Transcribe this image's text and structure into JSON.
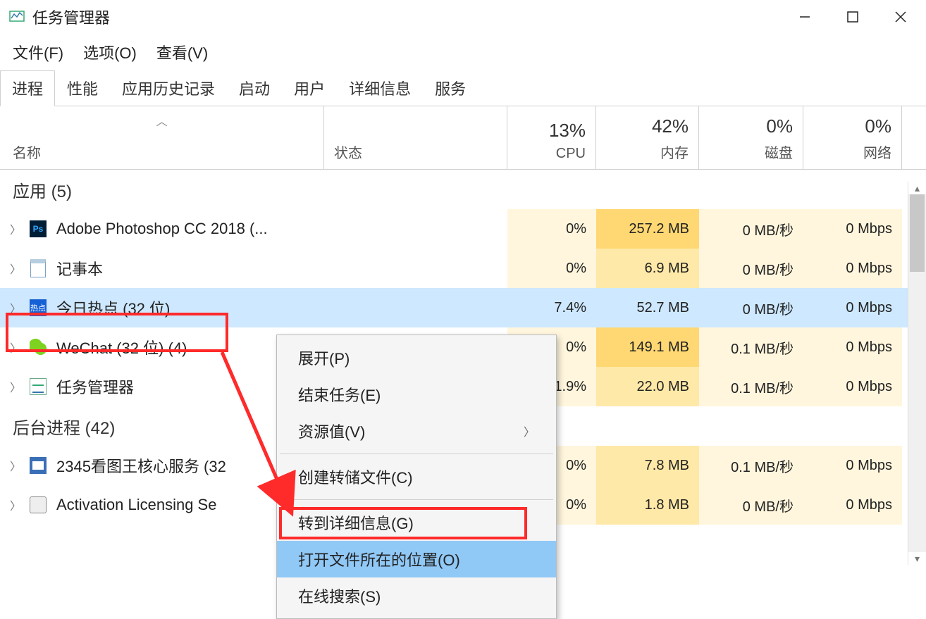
{
  "window": {
    "title": "任务管理器"
  },
  "menu": {
    "file": "文件(F)",
    "options": "选项(O)",
    "view": "查看(V)"
  },
  "tabs": [
    "进程",
    "性能",
    "应用历史记录",
    "启动",
    "用户",
    "详细信息",
    "服务"
  ],
  "active_tab": 0,
  "columns": {
    "name": "名称",
    "state": "状态",
    "cpu": {
      "pct": "13%",
      "label": "CPU"
    },
    "mem": {
      "pct": "42%",
      "label": "内存"
    },
    "disk": {
      "pct": "0%",
      "label": "磁盘"
    },
    "net": {
      "pct": "0%",
      "label": "网络"
    }
  },
  "groups": {
    "apps": {
      "label": "应用 (5)"
    },
    "bg": {
      "label": "后台进程 (42)"
    }
  },
  "rows": [
    {
      "name": "Adobe Photoshop CC 2018 (...",
      "cpu": "0%",
      "mem": "257.2 MB",
      "disk": "0 MB/秒",
      "net": "0 Mbps",
      "icon": "ps"
    },
    {
      "name": "记事本",
      "cpu": "0%",
      "mem": "6.9 MB",
      "disk": "0 MB/秒",
      "net": "0 Mbps",
      "icon": "note"
    },
    {
      "name": "今日热点 (32 位)",
      "cpu": "7.4%",
      "mem": "52.7 MB",
      "disk": "0 MB/秒",
      "net": "0 Mbps",
      "icon": "hot",
      "selected": true
    },
    {
      "name": "WeChat (32 位) (4)",
      "cpu": "0%",
      "mem": "149.1 MB",
      "disk": "0.1 MB/秒",
      "net": "0 Mbps",
      "icon": "wechat"
    },
    {
      "name": "任务管理器",
      "cpu": "1.9%",
      "mem": "22.0 MB",
      "disk": "0.1 MB/秒",
      "net": "0 Mbps",
      "icon": "tm"
    }
  ],
  "bg_rows": [
    {
      "name": "2345看图王核心服务 (32",
      "cpu": "0%",
      "mem": "7.8 MB",
      "disk": "0.1 MB/秒",
      "net": "0 Mbps",
      "icon": "2345"
    },
    {
      "name": "Activation Licensing Se",
      "cpu": "0%",
      "mem": "1.8 MB",
      "disk": "0 MB/秒",
      "net": "0 Mbps",
      "icon": "act"
    }
  ],
  "context_menu": {
    "items": [
      {
        "label": "展开(P)"
      },
      {
        "label": "结束任务(E)"
      },
      {
        "label": "资源值(V)",
        "submenu": true
      },
      {
        "sep": true
      },
      {
        "label": "创建转储文件(C)"
      },
      {
        "sep": true
      },
      {
        "label": "转到详细信息(G)"
      },
      {
        "label": "打开文件所在的位置(O)",
        "highlight": true
      },
      {
        "label": "在线搜索(S)"
      }
    ]
  }
}
